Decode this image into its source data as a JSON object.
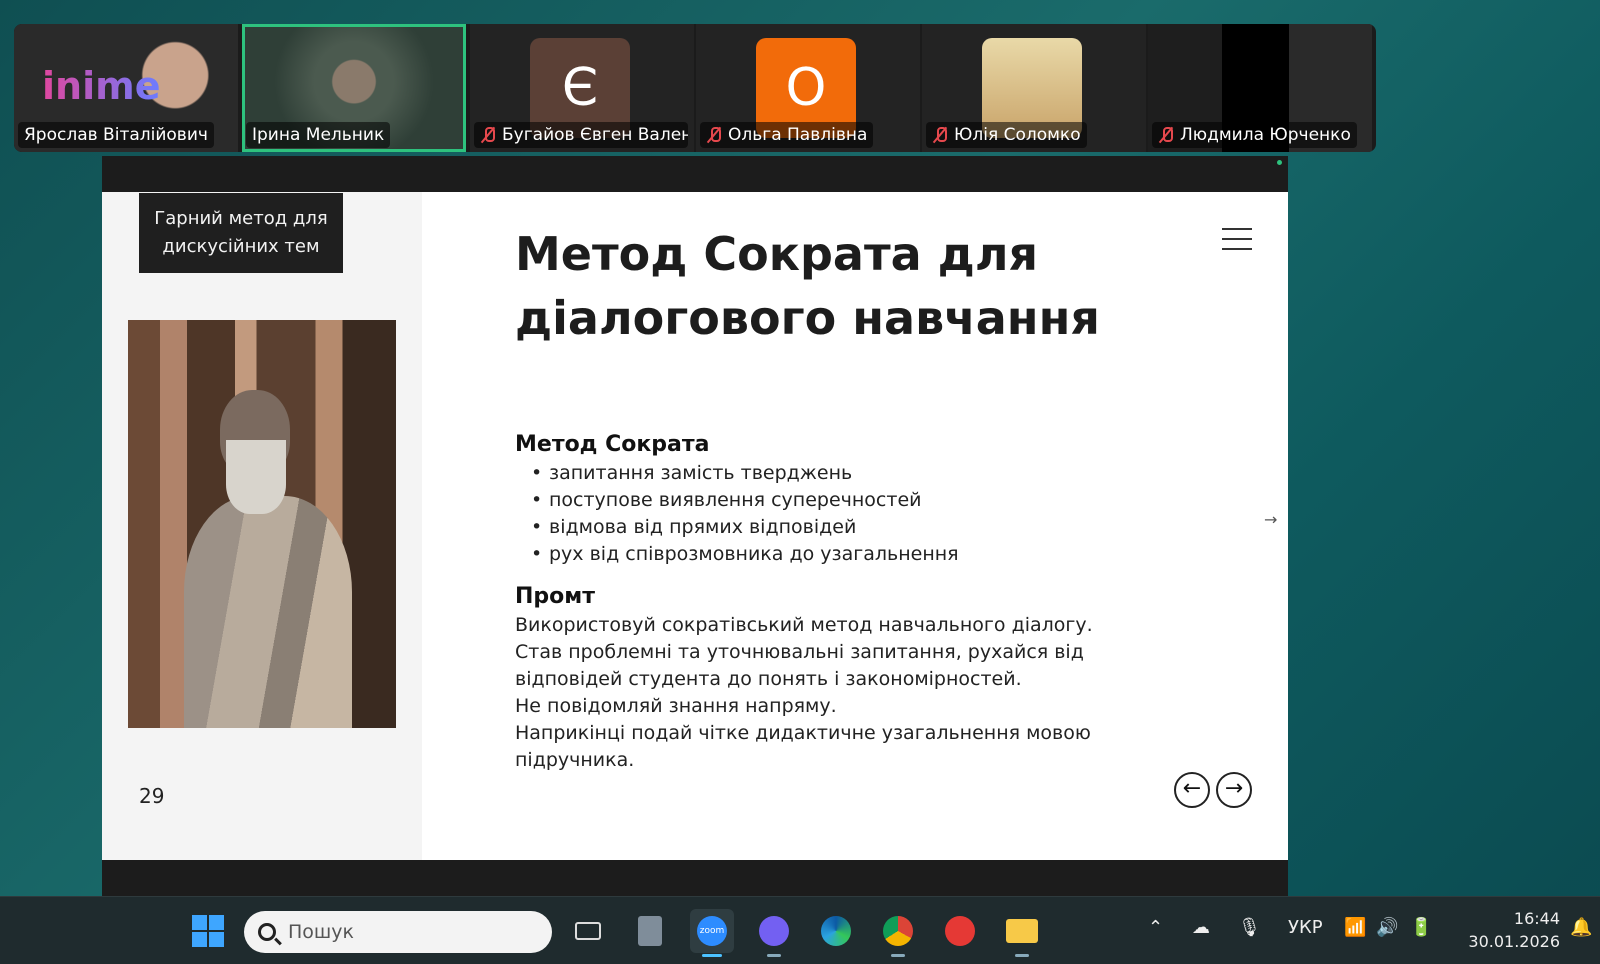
{
  "participants": [
    {
      "name": "Ярослав Віталійович",
      "muted": false,
      "logo_text": "inime"
    },
    {
      "name": "Ірина Мельник",
      "muted": false,
      "active": true
    },
    {
      "name": "Бугайов Євген Валент...",
      "muted": true,
      "initial": "Є",
      "color": "#5b4036"
    },
    {
      "name": "Ольга Павлівна",
      "muted": true,
      "initial": "О",
      "color": "#f26b0a"
    },
    {
      "name": "Юлія Соломко",
      "muted": true
    },
    {
      "name": "Людмила Юрченко",
      "muted": true
    }
  ],
  "slide": {
    "tag": "Гарний метод для дискусійних тем",
    "page_number": "29",
    "title": "Метод Сократа для діалогового навчання",
    "section1_title": "Метод Сократа",
    "bullets": [
      "запитання замість тверджень",
      "поступове виявлення суперечностей",
      "відмова від прямих відповідей",
      "рух від співрозмовника до узагальнення"
    ],
    "section2_title": "Промт",
    "prompt_lines": [
      "Використовуй сократівський метод навчального діалогу.",
      "Став проблемні та уточнювальні запитання, рухайся від відповідей студента до понять і закономірностей.",
      "Не повідомляй знання напряму.",
      "Наприкінці подай чітке дидактичне узагальнення мовою підручника."
    ],
    "nav_prev": "←",
    "nav_next": "→",
    "side_arrow": "→"
  },
  "taskbar": {
    "search_placeholder": "Пошук",
    "language": "УКР",
    "time": "16:44",
    "date": "30.01.2026",
    "apps": [
      "task-view",
      "calculator",
      "zoom",
      "viber",
      "edge",
      "chrome",
      "wps-office",
      "file-explorer"
    ]
  },
  "colors": {
    "accent_green": "#2ec27e",
    "windows_blue": "#3ea6ff",
    "mute_red": "#e5484d"
  }
}
